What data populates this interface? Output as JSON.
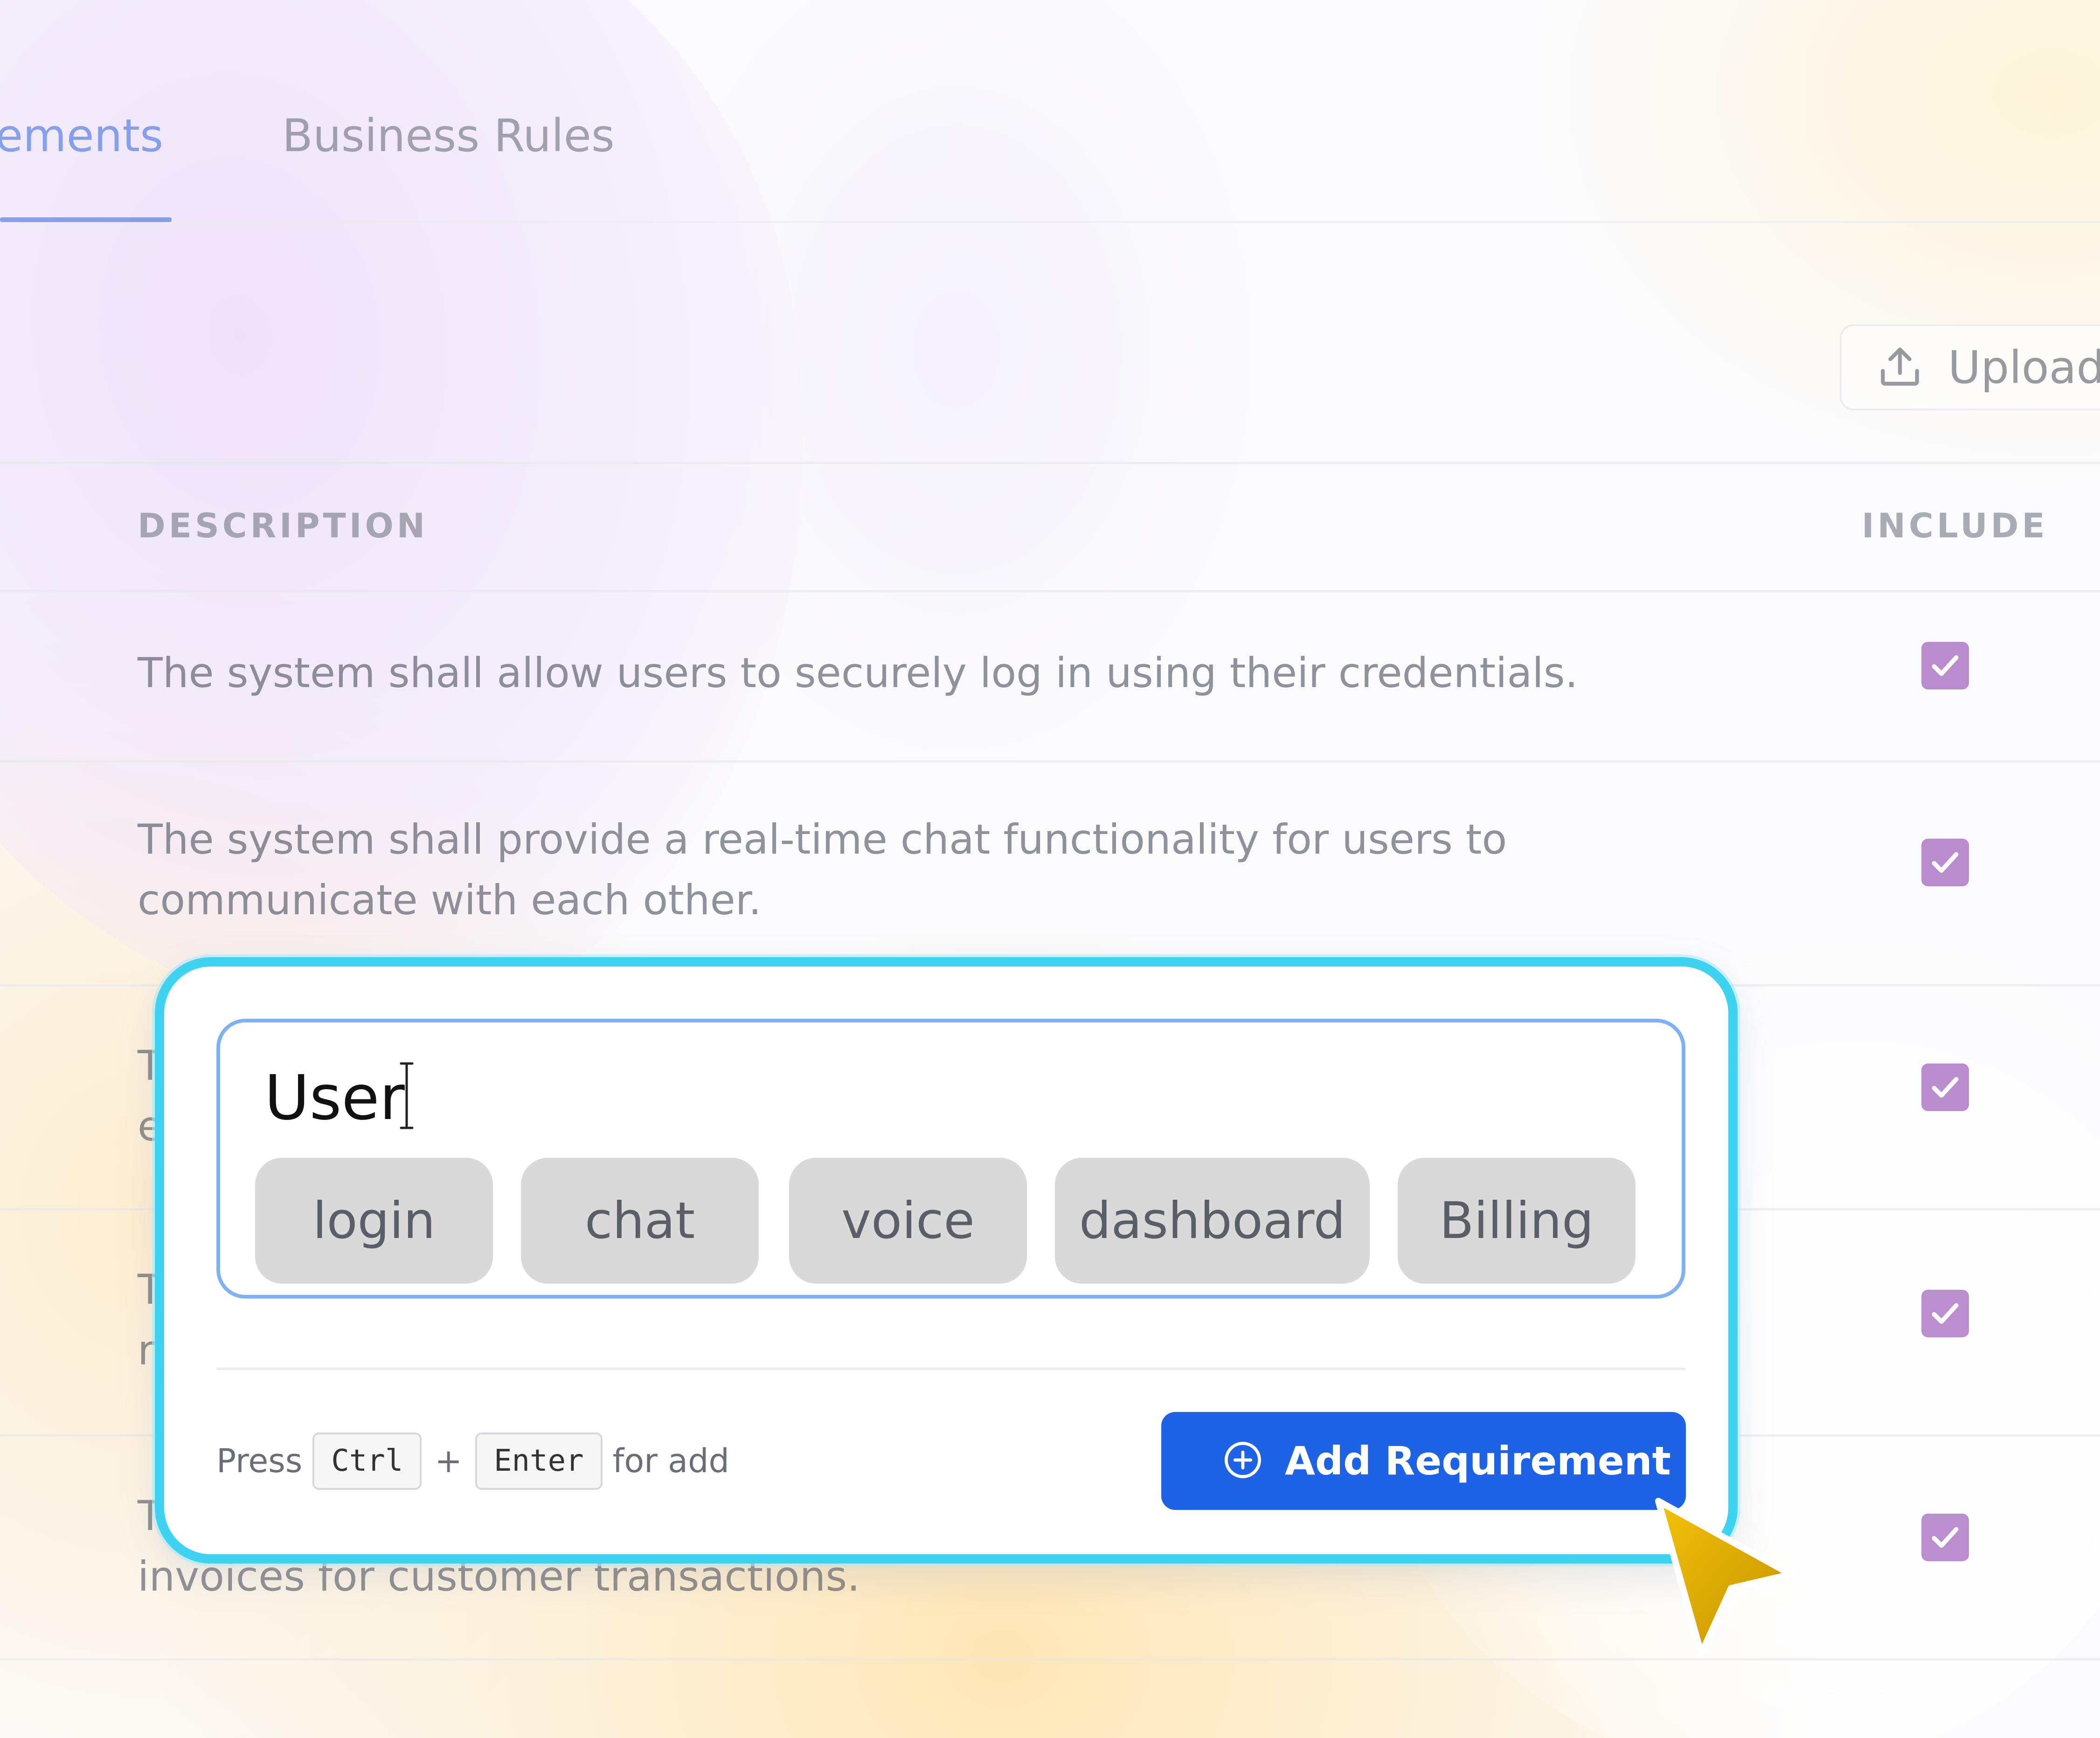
{
  "tabs": [
    {
      "label": "ements",
      "active": true
    },
    {
      "label": "Business Rules",
      "active": false
    }
  ],
  "toolbar": {
    "upload_label": "Upload",
    "upload_icon": "upload-icon"
  },
  "table": {
    "columns": [
      "DESCRIPTION",
      "INCLUDE"
    ],
    "rows": [
      {
        "description": "The system shall allow users to securely log in using their credentials.",
        "included": true
      },
      {
        "description": "The system shall provide a real-time chat functionality for users to communicate with each other.",
        "included": true
      },
      {
        "description": "T\ne",
        "included": true
      },
      {
        "description": "T\nr",
        "included": true
      },
      {
        "description": "T\ninvoices for customer transactions.",
        "included": true
      }
    ]
  },
  "composer": {
    "input_value": "User",
    "suggestions": [
      "login",
      "chat",
      "voice",
      "dashboard",
      "Billing"
    ],
    "hint": {
      "press": "Press",
      "key1": "Ctrl",
      "plus": "+",
      "key2": "Enter",
      "suffix": "for add"
    },
    "add_button_label": "Add Requirement",
    "add_button_icon": "plus-circle-icon"
  },
  "colors": {
    "accent_blue": "#1e62e6",
    "tab_active": "#3f6fe0",
    "card_border": "#3fd3f2",
    "checkbox": "#8e44b0",
    "cursor": "#e0b000"
  }
}
